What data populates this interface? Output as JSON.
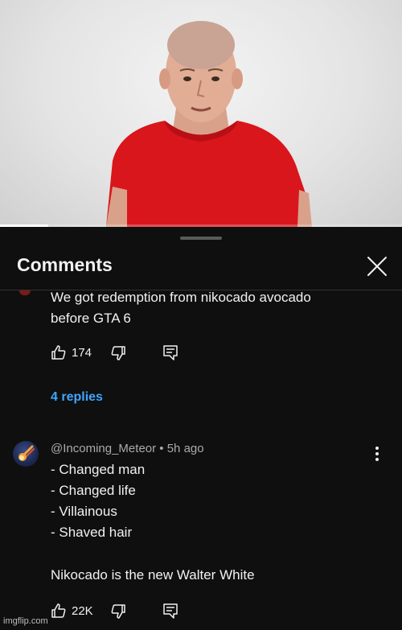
{
  "video": {
    "progress": 0.12
  },
  "sheet": {
    "title": "Comments"
  },
  "comment1": {
    "text_line1": "We got redemption from nikocado avocado",
    "text_line2": "before GTA 6",
    "likes": "174",
    "replies_label": "4 replies"
  },
  "comment2": {
    "author": "@Incoming_Meteor",
    "time": "5h ago",
    "lines": [
      "- Changed man",
      "- Changed life",
      "- Villainous",
      "- Shaved hair",
      "",
      "Nikocado is the new Walter White"
    ],
    "likes": "22K"
  },
  "watermark": "imgflip.com",
  "colors": {
    "background": "#0f0f0f",
    "link": "#3ea6ff",
    "shirt": "#d9161c",
    "muted": "#aaaaaa"
  },
  "icons": [
    "thumbs-up-icon",
    "thumbs-down-icon",
    "reply-icon",
    "close-icon",
    "more-vert-icon"
  ]
}
